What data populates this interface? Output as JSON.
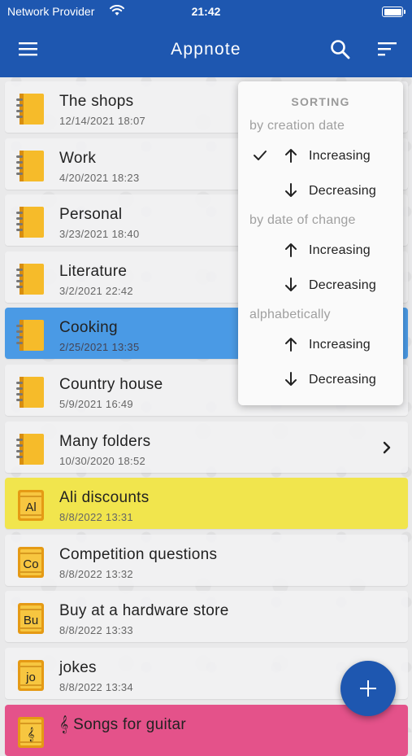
{
  "status_bar": {
    "provider": "Network Provider",
    "time": "21:42"
  },
  "header": {
    "title": "Appnote",
    "icons": {
      "menu": "hamburger-menu-icon",
      "search": "search-icon",
      "sort": "sort-icon"
    },
    "color": "#1e57b0"
  },
  "notes": [
    {
      "title": "The shops",
      "date": "12/14/2021 18:07",
      "type": "folder",
      "color": "default"
    },
    {
      "title": "Work",
      "date": "4/20/2021 18:23",
      "type": "folder",
      "color": "default"
    },
    {
      "title": "Personal",
      "date": "3/23/2021 18:40",
      "type": "folder",
      "color": "default"
    },
    {
      "title": "Literature",
      "date": "3/2/2021 22:42",
      "type": "folder",
      "color": "default"
    },
    {
      "title": "Cooking",
      "date": "2/25/2021 13:35",
      "type": "folder",
      "color": "#4a9ae5"
    },
    {
      "title": "Country house",
      "date": "5/9/2021 16:49",
      "type": "folder",
      "color": "default"
    },
    {
      "title": "Many folders",
      "date": "10/30/2020 18:52",
      "type": "folder",
      "color": "default",
      "has_chevron": true
    },
    {
      "title": "Ali discounts",
      "date": "8/8/2022 13:31",
      "type": "note",
      "badge": "Al",
      "color": "#f1e54d"
    },
    {
      "title": "Competition questions",
      "date": "8/8/2022 13:32",
      "type": "note",
      "badge": "Co",
      "color": "default"
    },
    {
      "title": "Buy at a hardware store",
      "date": "8/8/2022 13:33",
      "type": "note",
      "badge": "Bu",
      "color": "default"
    },
    {
      "title": "jokes",
      "date": "8/8/2022 13:34",
      "type": "note",
      "badge": "jo",
      "color": "default"
    },
    {
      "title": "𝄞 Songs for guitar",
      "date": "",
      "type": "note",
      "badge": "𝄞",
      "color": "#e4528a"
    }
  ],
  "sort_menu": {
    "header": "SORTING",
    "groups": [
      {
        "label": "by creation date",
        "options": [
          {
            "label": "Increasing",
            "direction": "up",
            "checked": true
          },
          {
            "label": "Decreasing",
            "direction": "down",
            "checked": false
          }
        ]
      },
      {
        "label": "by date of change",
        "options": [
          {
            "label": "Increasing",
            "direction": "up",
            "checked": false
          },
          {
            "label": "Decreasing",
            "direction": "down",
            "checked": false
          }
        ]
      },
      {
        "label": "alphabetically",
        "options": [
          {
            "label": "Increasing",
            "direction": "up",
            "checked": false
          },
          {
            "label": "Decreasing",
            "direction": "down",
            "checked": false
          }
        ]
      }
    ]
  },
  "fab": {
    "icon": "plus-icon"
  }
}
